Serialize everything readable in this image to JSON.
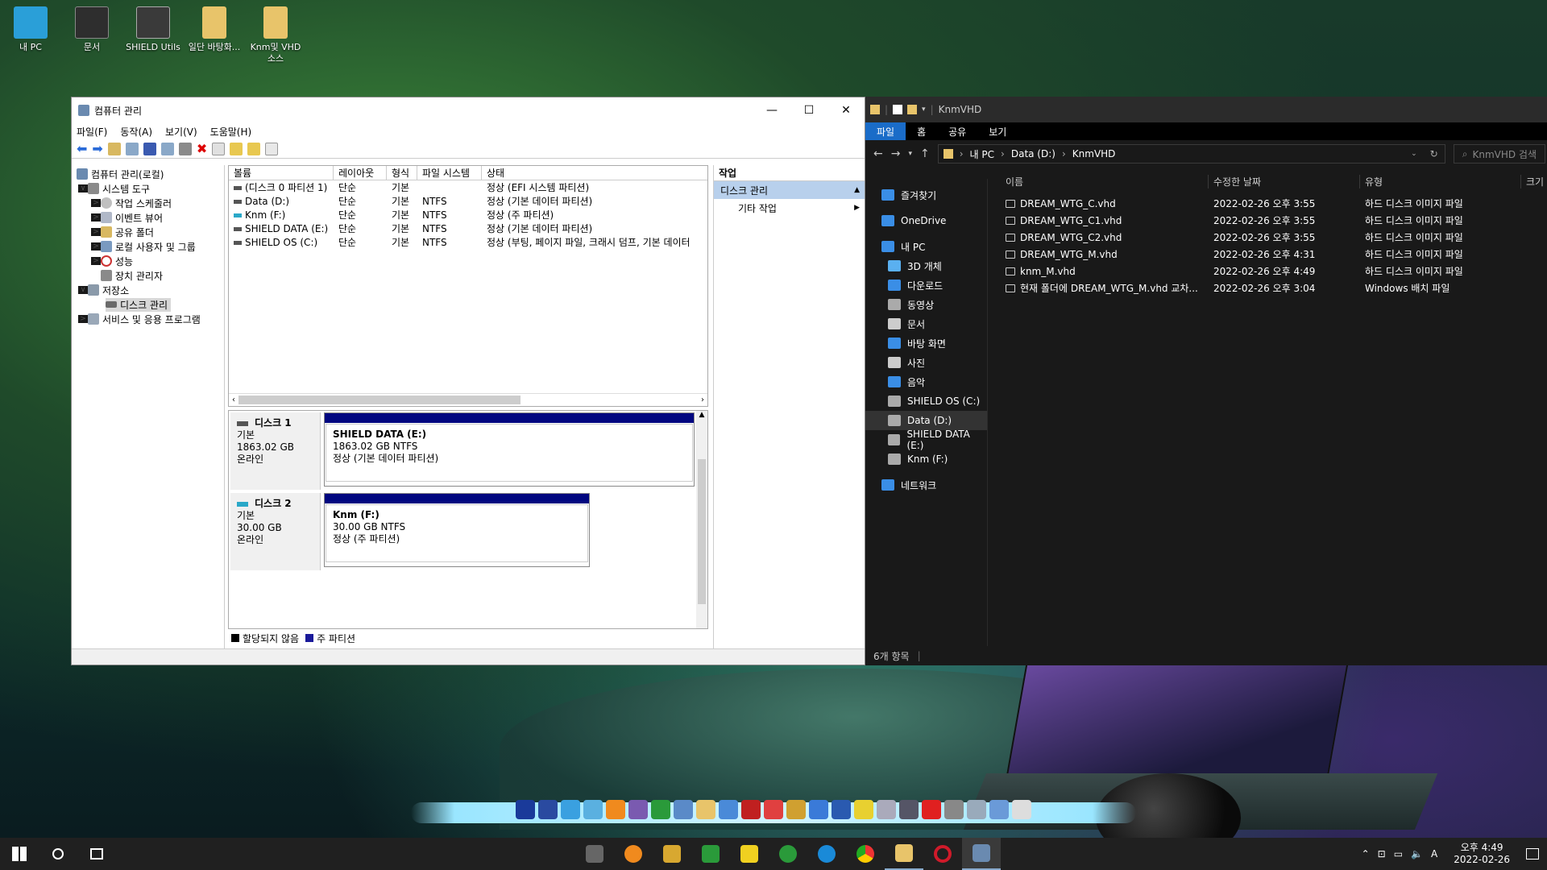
{
  "desktop_icons": [
    {
      "label": "내 PC",
      "color": "#2a9fd8"
    },
    {
      "label": "문서",
      "color": "#333"
    },
    {
      "label": "SHIELD Utils",
      "color": "#444"
    },
    {
      "label": "일단 바탕화...",
      "color": "#e8c46a"
    },
    {
      "label": "Knm및 VHD 소스",
      "color": "#e8c46a"
    }
  ],
  "cm": {
    "title": "컴퓨터 관리",
    "menu": [
      "파일(F)",
      "동작(A)",
      "보기(V)",
      "도움말(H)"
    ],
    "tree": [
      {
        "label": "컴퓨터 관리(로컬)",
        "level": 0,
        "exp": ""
      },
      {
        "label": "시스템 도구",
        "level": 1,
        "exp": "∨"
      },
      {
        "label": "작업 스케줄러",
        "level": 2,
        "exp": ">"
      },
      {
        "label": "이벤트 뷰어",
        "level": 2,
        "exp": ">"
      },
      {
        "label": "공유 폴더",
        "level": 2,
        "exp": ">"
      },
      {
        "label": "로컬 사용자 및 그룹",
        "level": 2,
        "exp": ">"
      },
      {
        "label": "성능",
        "level": 2,
        "exp": ">"
      },
      {
        "label": "장치 관리자",
        "level": 2,
        "exp": ""
      },
      {
        "label": "저장소",
        "level": 1,
        "exp": "∨"
      },
      {
        "label": "디스크 관리",
        "level": 2,
        "exp": "",
        "selected": true
      },
      {
        "label": "서비스 및 응용 프로그램",
        "level": 1,
        "exp": ">"
      }
    ],
    "columns": [
      "볼륨",
      "레이아웃",
      "형식",
      "파일 시스템",
      "상태"
    ],
    "volumes": [
      [
        "(디스크 0 파티션 1)",
        "단순",
        "기본",
        "",
        "정상 (EFI 시스템 파티션)"
      ],
      [
        "Data (D:)",
        "단순",
        "기본",
        "NTFS",
        "정상 (기본 데이터 파티션)"
      ],
      [
        "Knm (F:)",
        "단순",
        "기본",
        "NTFS",
        "정상 (주 파티션)"
      ],
      [
        "SHIELD DATA (E:)",
        "단순",
        "기본",
        "NTFS",
        "정상 (기본 데이터 파티션)"
      ],
      [
        "SHIELD OS (C:)",
        "단순",
        "기본",
        "NTFS",
        "정상 (부팅, 페이지 파일, 크래시 덤프, 기본 데이터"
      ]
    ],
    "disks": [
      {
        "name": "디스크 1",
        "type": "기본",
        "size": "1863.02 GB",
        "status": "온라인",
        "part_name": "SHIELD DATA  (E:)",
        "part_size": "1863.02 GB NTFS",
        "part_status": "정상 (기본 데이터 파티션)"
      },
      {
        "name": "디스크 2",
        "type": "기본",
        "size": "30.00 GB",
        "status": "온라인",
        "part_name": "Knm  (F:)",
        "part_size": "30.00 GB NTFS",
        "part_status": "정상 (주 파티션)"
      }
    ],
    "legend": [
      "할당되지 않음",
      "주 파티션"
    ],
    "actions_header": "작업",
    "actions_section": "디스크 관리",
    "actions_item": "기타 작업"
  },
  "ex": {
    "title": "KnmVHD",
    "ribbon": [
      "파일",
      "홈",
      "공유",
      "보기"
    ],
    "crumbs": [
      "내 PC",
      "Data (D:)",
      "KnmVHD"
    ],
    "search_placeholder": "KnmVHD 검색",
    "nav": [
      {
        "label": "즐겨찾기",
        "icon": "star-icon",
        "color": "#3a8ee6"
      },
      {
        "label": "OneDrive",
        "icon": "cloud-icon",
        "color": "#3a8ee6"
      },
      {
        "label": "내 PC",
        "icon": "pc-icon",
        "color": "#3a8ee6"
      },
      {
        "label": "3D 개체",
        "icon": "cube-icon",
        "color": "#5ab0f0"
      },
      {
        "label": "다운로드",
        "icon": "download-icon",
        "color": "#3a8ee6"
      },
      {
        "label": "동영상",
        "icon": "video-icon",
        "color": "#aaa"
      },
      {
        "label": "문서",
        "icon": "document-icon",
        "color": "#ccc"
      },
      {
        "label": "바탕 화면",
        "icon": "desktop-icon",
        "color": "#3a8ee6"
      },
      {
        "label": "사진",
        "icon": "picture-icon",
        "color": "#ccc"
      },
      {
        "label": "음악",
        "icon": "music-icon",
        "color": "#3a8ee6"
      },
      {
        "label": "SHIELD OS (C:)",
        "icon": "drive-icon",
        "color": "#aaa"
      },
      {
        "label": "Data (D:)",
        "icon": "drive-icon",
        "color": "#aaa",
        "selected": true
      },
      {
        "label": "SHIELD DATA (E:)",
        "icon": "drive-icon",
        "color": "#aaa"
      },
      {
        "label": "Knm (F:)",
        "icon": "drive-icon",
        "color": "#aaa"
      },
      {
        "label": "네트워크",
        "icon": "network-icon",
        "color": "#3a8ee6"
      }
    ],
    "columns": [
      "이름",
      "수정한 날짜",
      "유형",
      "크기"
    ],
    "files": [
      [
        "DREAM_WTG_C.vhd",
        "2022-02-26 오후 3:55",
        "하드 디스크 이미지 파일"
      ],
      [
        "DREAM_WTG_C1.vhd",
        "2022-02-26 오후 3:55",
        "하드 디스크 이미지 파일"
      ],
      [
        "DREAM_WTG_C2.vhd",
        "2022-02-26 오후 3:55",
        "하드 디스크 이미지 파일"
      ],
      [
        "DREAM_WTG_M.vhd",
        "2022-02-26 오후 4:31",
        "하드 디스크 이미지 파일"
      ],
      [
        "knm_M.vhd",
        "2022-02-26 오후 4:49",
        "하드 디스크 이미지 파일"
      ],
      [
        "현재 폴더에 DREAM_WTG_M.vhd 교차...",
        "2022-02-26 오후 3:04",
        "Windows 배치 파일"
      ]
    ],
    "status": "6개 항목"
  },
  "taskbar": {
    "time": "오후 4:49",
    "date": "2022-02-26",
    "ime": "A"
  }
}
